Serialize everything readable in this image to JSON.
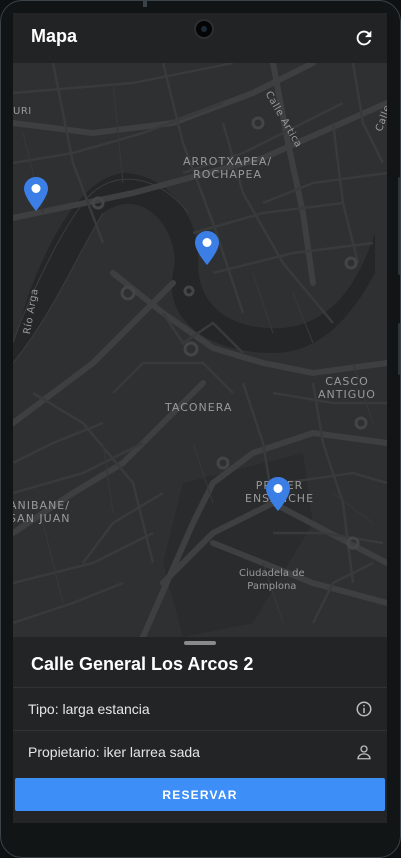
{
  "appbar": {
    "title": "Mapa",
    "refresh_icon": "refresh-icon"
  },
  "map": {
    "labels": {
      "north_left": "URI",
      "calle_artica": "Calle Artica",
      "calle_right": "Calle L",
      "arrotxapea": "ARROTXAPEA/\nROCHAPEA",
      "rio_arga": "Río Arga",
      "casco_antiguo": "CASCO\nANTIGUO",
      "taconera": "TACONERA",
      "primer_ensanche": "PRIMER\nENSANCHE",
      "san_juan": "ANIBANE/\nSAN JUAN",
      "ciudadela": "Ciudadela de\nPamplona"
    },
    "pin_color": "#3a7ee6",
    "pin_icon": "location-pin-icon"
  },
  "sheet": {
    "title": "Calle General Los Arcos 2",
    "tipo_label": "Tipo: larga estancia",
    "tipo_icon": "info-icon",
    "owner_label": "Propietario: iker larrea sada",
    "owner_icon": "person-icon",
    "reserve_label": "RESERVAR"
  },
  "colors": {
    "accent": "#3d8ef7",
    "background": "#232425"
  }
}
